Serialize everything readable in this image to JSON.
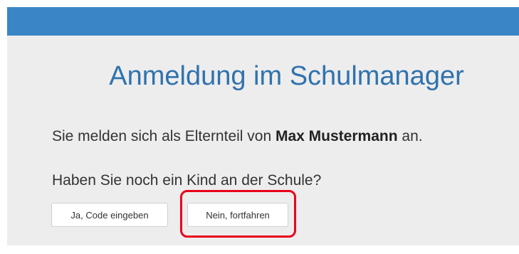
{
  "header": {
    "title": "Anmeldung im Schulmanager"
  },
  "main": {
    "info_prefix": "Sie melden sich als Elternteil von",
    "child_name": "Max Mustermann",
    "info_suffix": "an.",
    "question": "Haben Sie noch ein Kind an der Schule?"
  },
  "actions": {
    "yes_label": "Ja, Code eingeben",
    "no_label": "Nein, fortfahren"
  },
  "colors": {
    "brand": "#3a85c6",
    "title": "#3072ad",
    "highlight": "#e8001b"
  }
}
